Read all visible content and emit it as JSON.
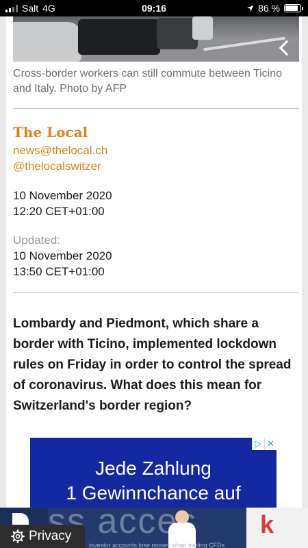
{
  "status_bar": {
    "carrier": "Salt",
    "network": "4G",
    "time": "09:16",
    "battery": "86 %",
    "battery_level": 0.86,
    "icons": [
      "signal-bars-icon",
      "location-arrow-icon",
      "battery-icon"
    ]
  },
  "article": {
    "photo_caption": "Cross-border workers can still commute between Ticino and Italy. Photo by AFP",
    "author": {
      "name": "The Local",
      "email": "news@thelocal.ch",
      "twitter": "@thelocalswitzer"
    },
    "published_date": "10 November 2020",
    "published_time": "12:20 CET+01:00",
    "updated_label": "Updated:",
    "updated_date": "10 November 2020",
    "updated_time": "13:50 CET+01:00",
    "lead": "Lombardy and Piedmont, which share a border with Ticino, implemented lockdown rules on Friday in order to control the spread of coronavirus. What does this mean for Switzerland's border region?"
  },
  "ad": {
    "line1": "Jede Zahlung",
    "line2": "1 Gewinnchance auf",
    "choices_icon": "ad-choices-icon",
    "close_icon": "close-icon",
    "choices_glyph": "▷",
    "close_glyph": "✕"
  },
  "banner": {
    "big_text": "ss acces",
    "small_text": "investor accounts lose money when trading CFDs",
    "right_glyph": "k"
  },
  "privacy": {
    "label": "Privacy",
    "icon": "gear-icon"
  },
  "colors": {
    "accent": "#e27f1b",
    "ad_background": "#1428a0",
    "banner_background": "#223a6e"
  }
}
